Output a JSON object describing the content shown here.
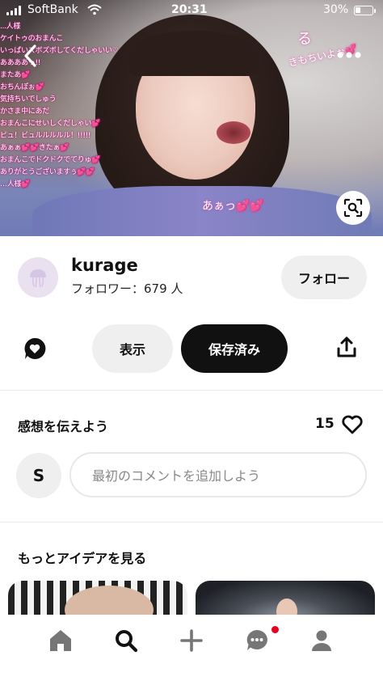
{
  "status_bar": {
    "carrier": "SoftBank",
    "time": "20:31",
    "battery_pct": "30%"
  },
  "pin_overlay": {
    "chat_lines": [
      "...人様",
      "ケイトゥのおまんこ",
      "いっぱいズボズボしてくだしゃいい♡",
      "ああああっ!!",
      "またあ💕",
      "おちんぽぉ💕",
      "気持ちいでしゅう",
      "かさま中にあだ",
      "おまんこにせいしくだしゃい💕",
      "ピュ！ビュルルルルル！!!!!!",
      "あぁぁ💕💕きたぁ💕",
      "おまんこでドクドクでてりゅ💕",
      "ありがとうございますぅ💕💕",
      "…人様💕"
    ],
    "float_1": "きもちいよぉ💕",
    "float_2": "あぁっ💕💕",
    "float_3": "る"
  },
  "creator": {
    "name": "kurage",
    "followers": "フォロワー：679 人",
    "follow_label": "フォロー"
  },
  "actions": {
    "view_label": "表示",
    "saved_label": "保存済み"
  },
  "reactions": {
    "title": "感想を伝えよう",
    "count": "15"
  },
  "comment": {
    "user_initial": "S",
    "placeholder": "最初のコメントを追加しよう"
  },
  "more_ideas": {
    "title": "もっとアイデアを見る"
  },
  "icons": {
    "back": "chevron-left-icon",
    "more": "more-dots-icon",
    "lens": "visual-search-icon",
    "comment": "comment-heart-icon",
    "share": "share-icon",
    "like": "heart-outline-icon",
    "nav": [
      "home-icon",
      "search-icon",
      "plus-icon",
      "messages-icon",
      "profile-icon"
    ]
  },
  "colors": {
    "accent": "#111111",
    "button_bg": "#efefef",
    "notification": "#e60023"
  }
}
